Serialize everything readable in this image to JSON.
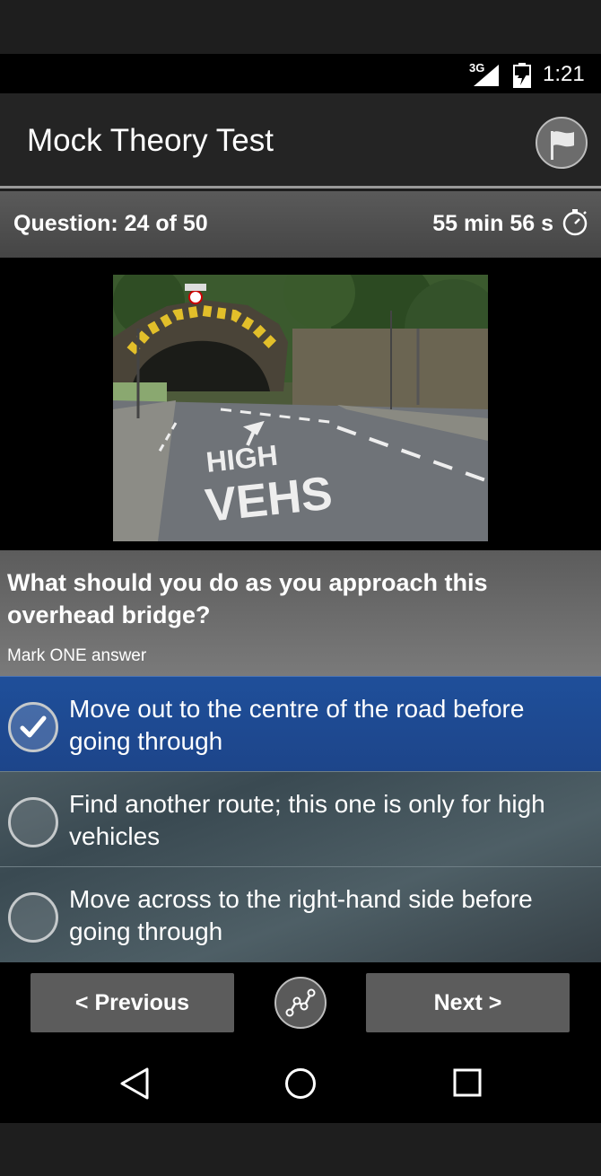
{
  "status_bar": {
    "network": "3G",
    "time": "1:21",
    "icons": [
      "signal-icon",
      "battery-charging-icon"
    ]
  },
  "app_bar": {
    "title": "Mock Theory Test",
    "flag_icon": "flag-icon"
  },
  "question_bar": {
    "question_label": "Question: 24 of 50",
    "timer": "55 min 56 s",
    "timer_icon": "stopwatch-icon"
  },
  "question": {
    "text": "What should you do as you approach this overhead bridge?",
    "instruction": "Mark ONE answer",
    "road_marking_text": [
      "HIGH",
      "VEHS"
    ]
  },
  "answers": [
    {
      "label": "Move out to the centre of the road before going through",
      "selected": true
    },
    {
      "label": "Find another route; this one is only for high vehicles",
      "selected": false
    },
    {
      "label": "Move across to the right-hand side before going through",
      "selected": false
    }
  ],
  "footer": {
    "previous_label": "< Previous",
    "next_label": "Next >",
    "progress_icon": "progress-chart-icon"
  },
  "system_nav": {
    "icons": [
      "back-icon",
      "home-icon",
      "recents-icon"
    ]
  },
  "colors": {
    "selected_answer": "#1f4f9a",
    "app_bar": "#242424",
    "button": "#5c5c5c"
  }
}
